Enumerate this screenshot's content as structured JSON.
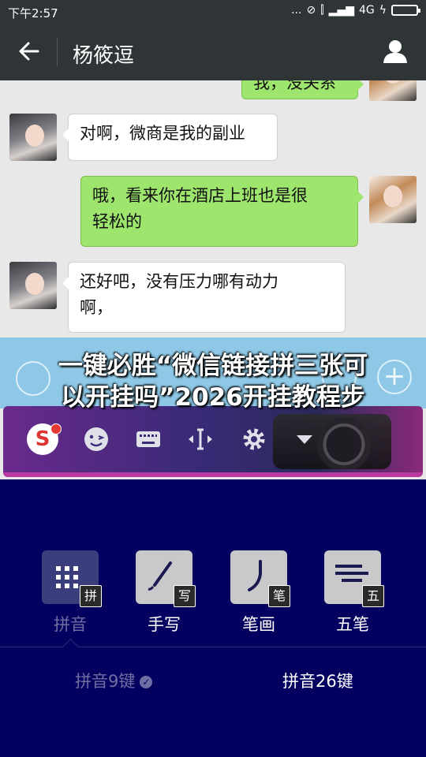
{
  "status_bar": {
    "time": "下午2:57",
    "dots": "...",
    "network": "4G"
  },
  "header": {
    "contact_name": "杨筱逗"
  },
  "chat": {
    "top_partial_message": "我，没关系",
    "messages": [
      {
        "side": "left",
        "text_lines": [
          "对啊，微商是我的副业"
        ]
      },
      {
        "side": "right",
        "text_lines": [
          "哦，看来你在酒店上班也是很",
          "轻松的"
        ]
      },
      {
        "side": "left",
        "text_lines": [
          "还好吧，没有压力哪有动力",
          "啊，"
        ]
      }
    ]
  },
  "overlay": {
    "title_line1": "一键必胜“微信链接拼三张可",
    "title_line2": "以开挂吗”2026开挂教程步"
  },
  "ime_toolbar": {
    "logo_letter": "S",
    "colors": {
      "accent_dot": "#e53935"
    }
  },
  "keyboard": {
    "input_modes": [
      {
        "label": "拼音",
        "badge": "拼",
        "selected": true
      },
      {
        "label": "手写",
        "badge": "写",
        "selected": false
      },
      {
        "label": "笔画",
        "badge": "笔",
        "selected": false
      },
      {
        "label": "五笔",
        "badge": "五",
        "selected": false
      }
    ],
    "layout_options": [
      {
        "label": "拼音9键",
        "selected": true
      },
      {
        "label": "拼音26键",
        "selected": false
      }
    ],
    "colors": {
      "background": "#04005f"
    }
  }
}
